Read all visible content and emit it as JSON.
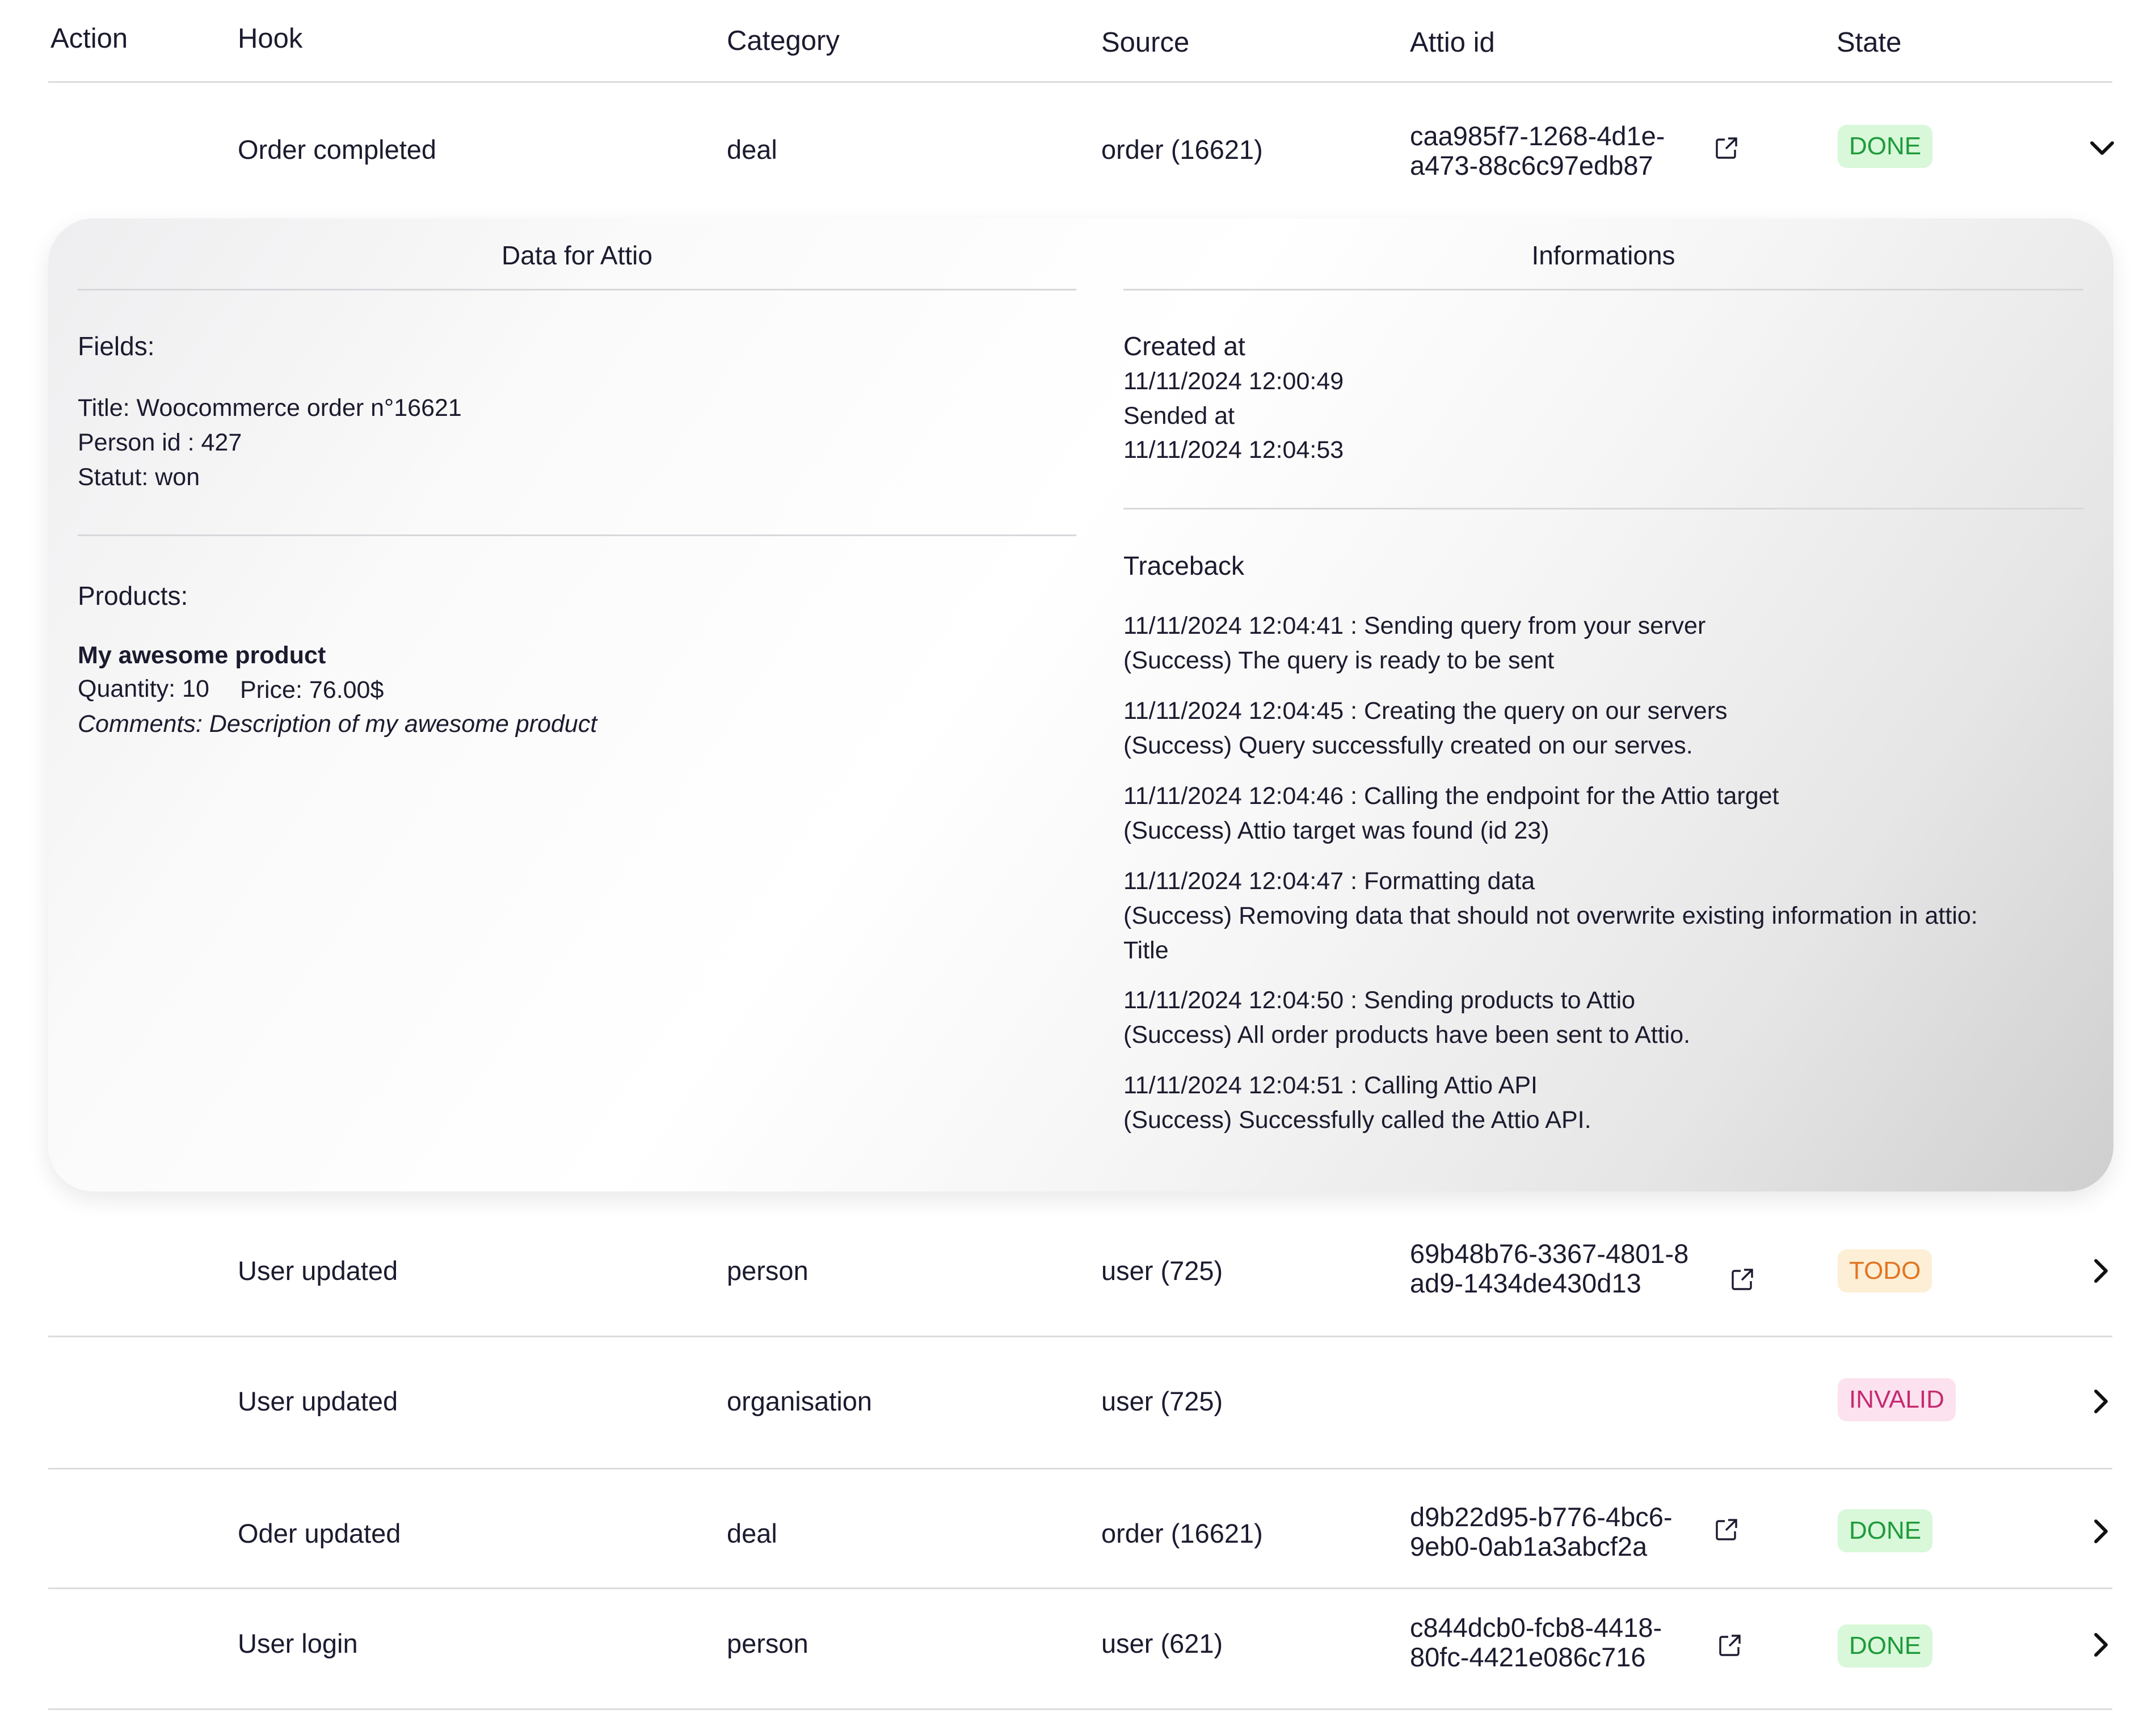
{
  "table": {
    "headers": {
      "action": "Action",
      "hook": "Hook",
      "category": "Category",
      "source": "Source",
      "attio_id": "Attio id",
      "state": "State"
    },
    "rows": [
      {
        "hook": "Order completed",
        "category": "deal",
        "source": "order (16621)",
        "attio_id_line1": "caa985f7-1268-4d1e-",
        "attio_id_line2": "a473-88c6c97edb87",
        "state": "DONE",
        "expanded": true
      },
      {
        "hook": "User updated",
        "category": "person",
        "source": "user (725)",
        "attio_id_line1": "69b48b76-3367-4801-8",
        "attio_id_line2": "ad9-1434de430d13",
        "state": "TODO",
        "expanded": false
      },
      {
        "hook": "User updated",
        "category": "organisation",
        "source": "user (725)",
        "attio_id_line1": "",
        "attio_id_line2": "",
        "state": "INVALID",
        "expanded": false
      },
      {
        "hook": "Oder updated",
        "category": "deal",
        "source": "order (16621)",
        "attio_id_line1": "d9b22d95-b776-4bc6-",
        "attio_id_line2": "9eb0-0ab1a3abcf2a",
        "state": "DONE",
        "expanded": false
      },
      {
        "hook": "User login",
        "category": "person",
        "source": "user (621)",
        "attio_id_line1": "c844dcb0-fcb8-4418-",
        "attio_id_line2": "80fc-4421e086c716",
        "state": "DONE",
        "expanded": false
      }
    ]
  },
  "details": {
    "data_title": "Data for Attio",
    "info_title": "Informations",
    "fields_label": "Fields:",
    "fields": [
      "Title: Woocommerce order n°16621",
      "Person id : 427",
      "Statut: won"
    ],
    "products_label": "Products:",
    "product": {
      "name": "My awesome product",
      "quantity": "Quantity: 10",
      "price": "Price: 76.00$",
      "comments": "Comments: Description of my awesome product"
    },
    "created_label": "Created at",
    "created_value": "11/11/2024 12:00:49",
    "sended_label": "Sended at",
    "sended_value": "11/11/2024 12:04:53",
    "traceback_label": "Traceback",
    "traceback": [
      {
        "line1": "11/11/2024 12:04:41 :  Sending query from your server",
        "line2": "(Success) The query is ready to be sent",
        "line3": ""
      },
      {
        "line1": "11/11/2024 12:04:45 : Creating the query on our servers",
        "line2": "(Success) Query successfully created on our serves.",
        "line3": ""
      },
      {
        "line1": "11/11/2024 12:04:46 : Calling the endpoint for the Attio target",
        "line2": "(Success) Attio target was found (id 23)",
        "line3": ""
      },
      {
        "line1": "11/11/2024 12:04:47 : Formatting data",
        "line2": "(Success) Removing data that should not overwrite existing information in attio:",
        "line3": "Title"
      },
      {
        "line1": "11/11/2024 12:04:50 : Sending products to Attio",
        "line2": "(Success) All order products have been sent to Attio.",
        "line3": ""
      },
      {
        "line1": "11/11/2024 12:04:51 :  Calling Attio API",
        "line2": "(Success) Successfully called the Attio API.",
        "line3": ""
      }
    ]
  },
  "colors": {
    "done_bg": "#d8f8d9",
    "done_text": "#1f9a3b",
    "todo_bg": "#fdefd5",
    "todo_text": "#e27523",
    "invalid_bg": "#fce1ee",
    "invalid_text": "#c52a72"
  },
  "icons": {
    "external_link": "external-link-icon",
    "expanded": "chevron-down-icon",
    "collapsed": "chevron-right-icon"
  }
}
